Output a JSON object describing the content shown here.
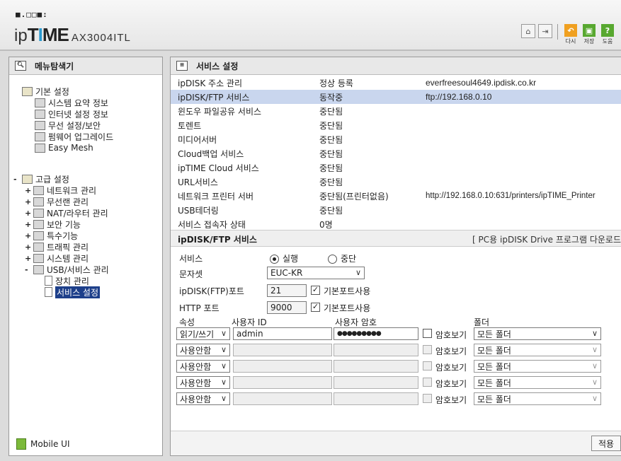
{
  "header": {
    "dots": "■.□□■:",
    "brand_ip": "ip",
    "brand_time_t": "T",
    "brand_time_i": "I",
    "brand_time_me": "ME",
    "model": "AX3004ITL",
    "buttons": [
      {
        "label": "다시",
        "icon": "back-icon"
      },
      {
        "label": "저장",
        "icon": "save-icon"
      },
      {
        "label": "도움",
        "icon": "help-icon"
      }
    ],
    "accent_colors": {
      "back": "#f0a020",
      "save": "#58a830",
      "help": "#58a830"
    }
  },
  "sidebar": {
    "title": "메뉴탐색기",
    "basic": {
      "label": "기본 설정",
      "items": [
        "시스템 요약 정보",
        "인터넷 설정 정보",
        "무선 설정/보안",
        "펌웨어 업그레이드",
        "Easy Mesh"
      ]
    },
    "advanced": {
      "label": "고급 설정",
      "items": [
        "네트워크 관리",
        "무선랜 관리",
        "NAT/라우터 관리",
        "보안 기능",
        "특수기능",
        "트래픽 관리",
        "시스템 관리",
        "USB/서비스 관리"
      ],
      "usb_children": [
        "장치 관리",
        "서비스 설정"
      ]
    },
    "expand_plus": "+",
    "expand_minus": "-",
    "mobile_label": "Mobile UI"
  },
  "main": {
    "title": "서비스 설정",
    "status_rows": [
      {
        "name": "ipDISK 주소 관리",
        "status": "정상 등록",
        "info": "everfreesoul4649.ipdisk.co.kr"
      },
      {
        "name": "ipDISK/FTP 서비스",
        "status": "동작중",
        "info": "ftp://192.168.0.10"
      },
      {
        "name": "윈도우 파일공유 서비스",
        "status": "중단됨",
        "info": ""
      },
      {
        "name": "토렌트",
        "status": "중단됨",
        "info": ""
      },
      {
        "name": "미디어서버",
        "status": "중단됨",
        "info": ""
      },
      {
        "name": "Cloud백업 서비스",
        "status": "중단됨",
        "info": ""
      },
      {
        "name": "ipTIME Cloud 서비스",
        "status": "중단됨",
        "info": ""
      },
      {
        "name": "URL서비스",
        "status": "중단됨",
        "info": ""
      },
      {
        "name": "네트워크 프린터 서버",
        "status": "중단됨(프린터없음)",
        "info": "http://192.168.0.10:631/printers/ipTIME_Printer"
      },
      {
        "name": "USB테더링",
        "status": "중단됨",
        "info": ""
      },
      {
        "name": "서비스 접속자 상태",
        "status": "0명",
        "info": ""
      }
    ],
    "section_title": "ipDISK/FTP 서비스",
    "download_link": "[ PC용 ipDISK Drive 프로그램 다운로드",
    "form": {
      "service_label": "서비스",
      "run_label": "실행",
      "stop_label": "중단",
      "charset_label": "문자셋",
      "charset_value": "EUC-KR",
      "ftp_port_label": "ipDISK(FTP)포트",
      "ftp_port_value": "21",
      "default_port_label": "기본포트사용",
      "http_port_label": "HTTP 포트",
      "http_port_value": "9000",
      "col_attr": "속성",
      "col_user": "사용자 ID",
      "col_pass": "사용자 암호",
      "col_folder": "폴더",
      "show_pass_label": "암호보기",
      "users": [
        {
          "attr": "읽기/쓰기",
          "id": "admin",
          "password": "●●●●●●●●●",
          "folder": "모든 폴더",
          "enabled": true
        },
        {
          "attr": "사용안함",
          "id": "",
          "password": "",
          "folder": "모든 폴더",
          "enabled": false
        },
        {
          "attr": "사용안함",
          "id": "",
          "password": "",
          "folder": "모든 폴더",
          "enabled": false
        },
        {
          "attr": "사용안함",
          "id": "",
          "password": "",
          "folder": "모든 폴더",
          "enabled": false
        },
        {
          "attr": "사용안함",
          "id": "",
          "password": "",
          "folder": "모든 폴더",
          "enabled": false
        }
      ]
    },
    "apply_label": "적용"
  }
}
